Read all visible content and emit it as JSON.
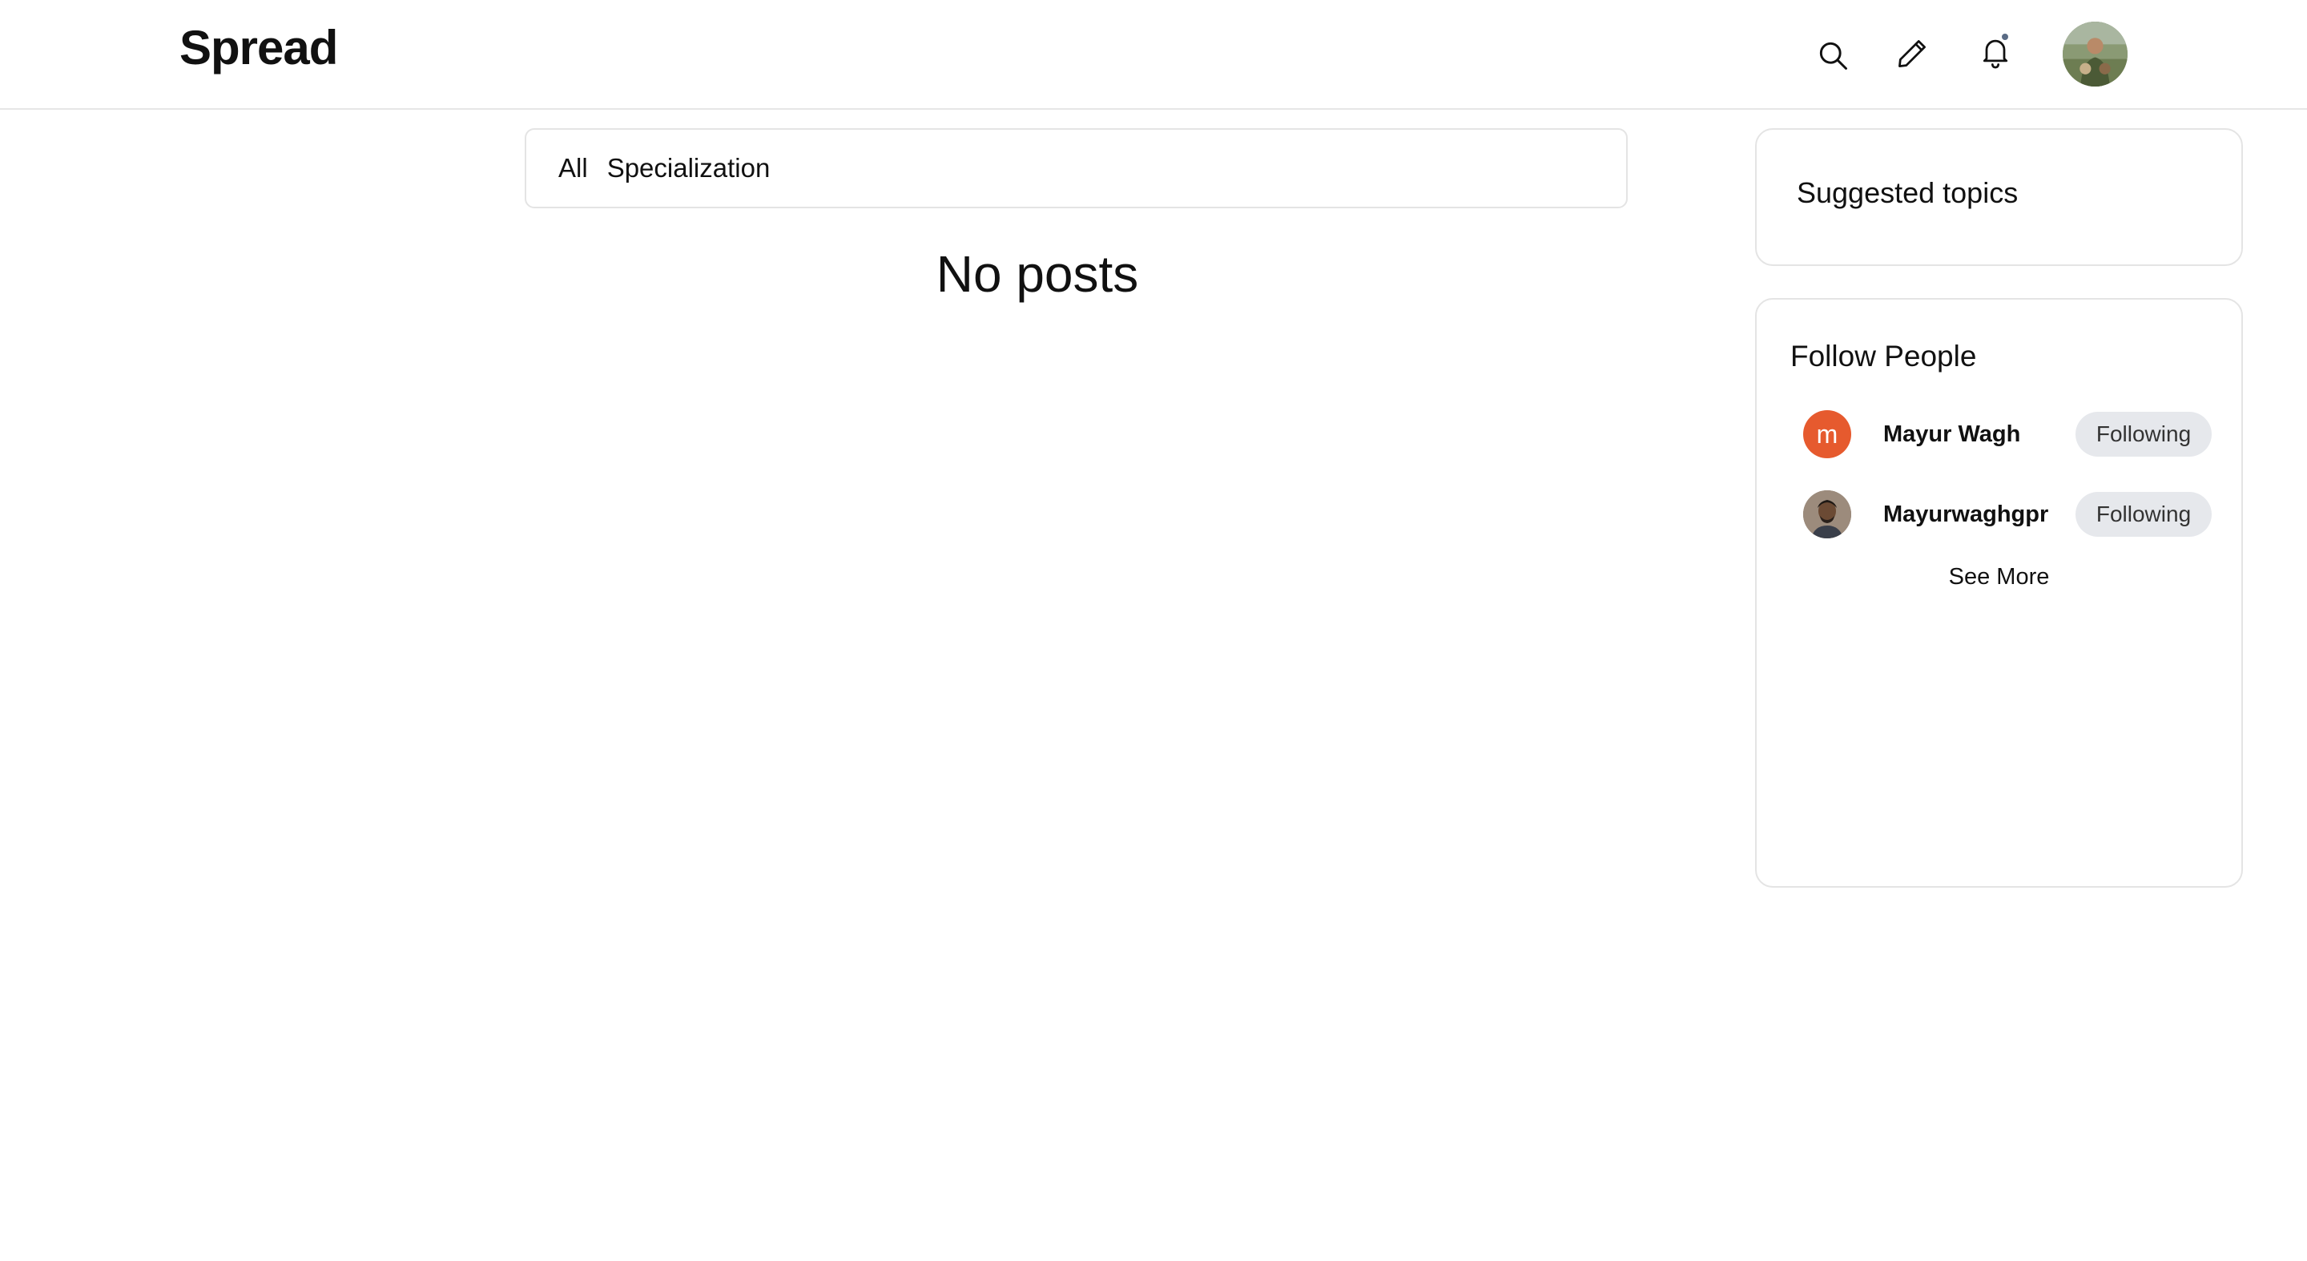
{
  "header": {
    "logo": "Spread",
    "icons": [
      "search-icon",
      "edit-icon",
      "bell-icon",
      "avatar"
    ],
    "has_notification": true
  },
  "filters": {
    "tabs": [
      "All",
      "Specialization"
    ]
  },
  "feed": {
    "empty_text": "No posts"
  },
  "sidebar": {
    "topics_title": "Suggested topics",
    "follow": {
      "title": "Follow People",
      "people": [
        {
          "initial": "m",
          "name": "Mayur Wagh",
          "button": "Following"
        },
        {
          "initial": "",
          "name": "Mayurwaghgpr",
          "button": "Following"
        }
      ],
      "see_more": "See More"
    }
  },
  "colors": {
    "initial_avatar": "#e65a2e",
    "following_button_bg": "#e6e8ec",
    "notification_dot": "#5a6b85",
    "border": "#e4e4e4"
  }
}
